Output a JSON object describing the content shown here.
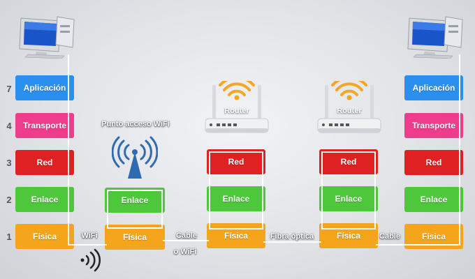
{
  "layer_numbers": [
    "7",
    "4",
    "3",
    "2",
    "1"
  ],
  "left_host": {
    "layers": {
      "app": "Aplicación",
      "transport": "Transporte",
      "network": "Red",
      "link": "Enlace",
      "physical": "Física"
    }
  },
  "right_host": {
    "layers": {
      "app": "Aplicación",
      "transport": "Transporte",
      "network": "Red",
      "link": "Enlace",
      "physical": "Física"
    }
  },
  "access_point": {
    "title": "Punto acceso WiFi",
    "link": "Enlace",
    "physical": "Física"
  },
  "router1": {
    "label": "Router",
    "network": "Red",
    "link": "Enlace",
    "physical": "Física"
  },
  "router2": {
    "label": "Router",
    "network": "Red",
    "link": "Enlace",
    "physical": "Física"
  },
  "connections": {
    "wifi": "WiFi",
    "cable_wifi_1": "Cable",
    "cable_wifi_2": "o WiFi",
    "fiber": "Fibra óptica",
    "cable": "Cable"
  },
  "colors": {
    "application": "#2b8ff0",
    "transport": "#ee3d8c",
    "network": "#e02121",
    "link": "#4cc83a",
    "physical": "#f5a51c",
    "wifi_orange": "#f5a623",
    "antenna_blue": "#2e6bb0"
  }
}
